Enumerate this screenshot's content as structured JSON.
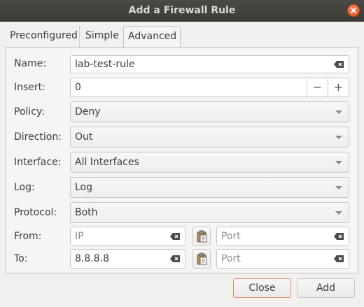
{
  "window": {
    "title": "Add a Firewall Rule"
  },
  "tabs": [
    {
      "label": "Preconfigured"
    },
    {
      "label": "Simple"
    },
    {
      "label": "Advanced"
    }
  ],
  "form": {
    "name": {
      "label": "Name:",
      "value": "lab-test-rule"
    },
    "insert": {
      "label": "Insert:",
      "value": "0",
      "decrement": "−",
      "increment": "+"
    },
    "policy": {
      "label": "Policy:",
      "value": "Deny"
    },
    "direction": {
      "label": "Direction:",
      "value": "Out"
    },
    "interface": {
      "label": "Interface:",
      "value": "All Interfaces"
    },
    "log": {
      "label": "Log:",
      "value": "Log"
    },
    "protocol": {
      "label": "Protocol:",
      "value": "Both"
    },
    "from": {
      "label": "From:",
      "ip_placeholder": "IP",
      "ip_value": "",
      "port_placeholder": "Port"
    },
    "to": {
      "label": "To:",
      "ip_value": "8.8.8.8",
      "port_placeholder": "Port"
    }
  },
  "buttons": {
    "close": "Close",
    "add": "Add"
  }
}
